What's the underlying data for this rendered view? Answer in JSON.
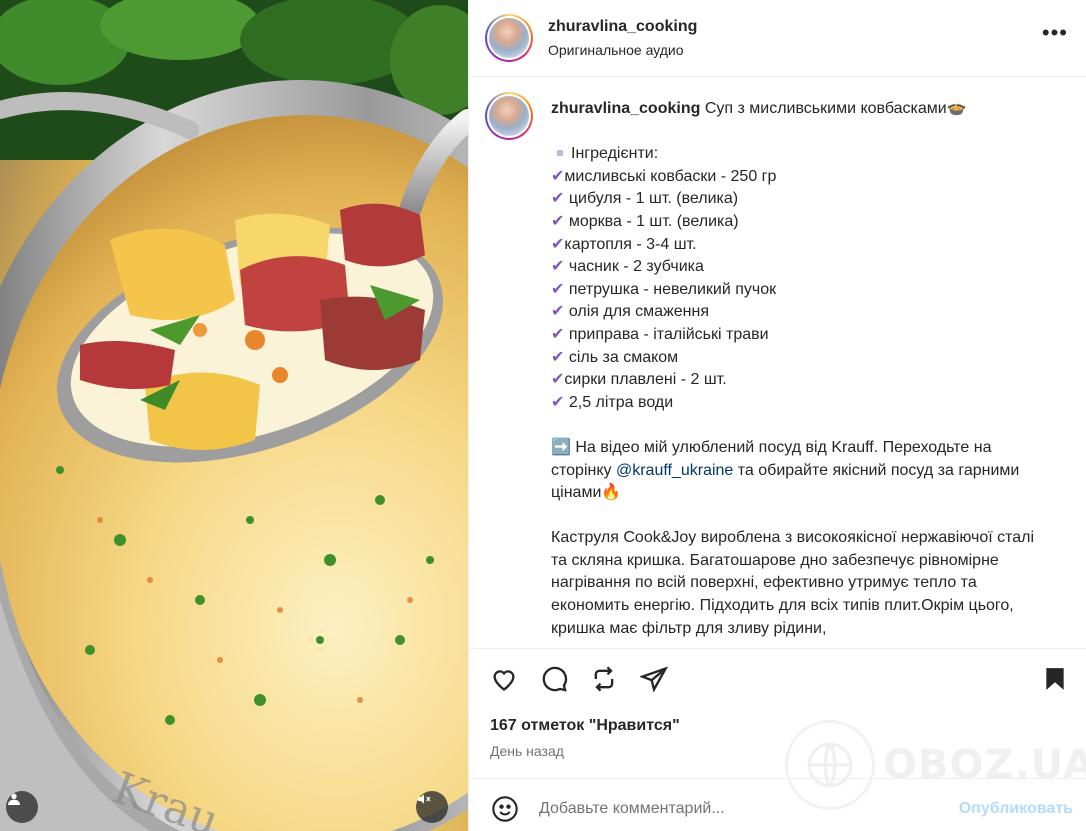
{
  "header": {
    "username": "zhuravlina_cooking",
    "audio": "Оригинальное аудио",
    "more_icon": "more-horizontal-icon"
  },
  "caption": {
    "username": "zhuravlina_cooking",
    "title": "Суп з мисливськими ковбасками",
    "title_emoji": "🍲",
    "ingredients_heading": "Інгредієнти:",
    "ingredients": [
      "мисливські ковбаски - 250 гр",
      " цибуля - 1 шт. (велика)",
      " морква - 1 шт. (велика)",
      "картопля - 3-4 шт.",
      " часник - 2 зубчика",
      " петрушка - невеликий пучок",
      " олія для смаження",
      " приправа - італійські трави",
      " сіль за смаком",
      "сирки плавлені - 2 шт.",
      " 2,5 літра води"
    ],
    "check_glyph": "✔",
    "promo_arrow": "➡️",
    "promo_before": "На відео мій улюблений посуд від Krauff. Переходьте на сторінку ",
    "promo_mention": "@krauff_ukraine",
    "promo_after": " та обирайте якісний посуд за гарними цінами",
    "promo_emoji": "🔥",
    "description": "Каструля Cook&Joy вироблена з високоякісної нержавіючої сталі та скляна кришка. Багатошарове дно забезпечує рівномірне нагрівання по всій поверхні, ефективно утримує тепло та економить енергію. Підходить для всіх типів плит.Окрім цього, кришка має фільтр для зливу рідини,"
  },
  "actions": {
    "like_icon": "heart-icon",
    "comment_icon": "comment-icon",
    "repost_icon": "repost-icon",
    "share_icon": "send-icon",
    "save_icon": "bookmark-icon",
    "likes_text": "167 отметок \"Нравится\"",
    "time_text": "День назад"
  },
  "comment": {
    "emoji_icon": "smiley-icon",
    "placeholder": "Добавьте комментарий...",
    "publish_label": "Опубликовать"
  },
  "watermark": {
    "text": "OBOZ.UA"
  },
  "media": {
    "corner_icon": "tagged-user-icon",
    "mute_icon": "speaker-muted-icon"
  }
}
